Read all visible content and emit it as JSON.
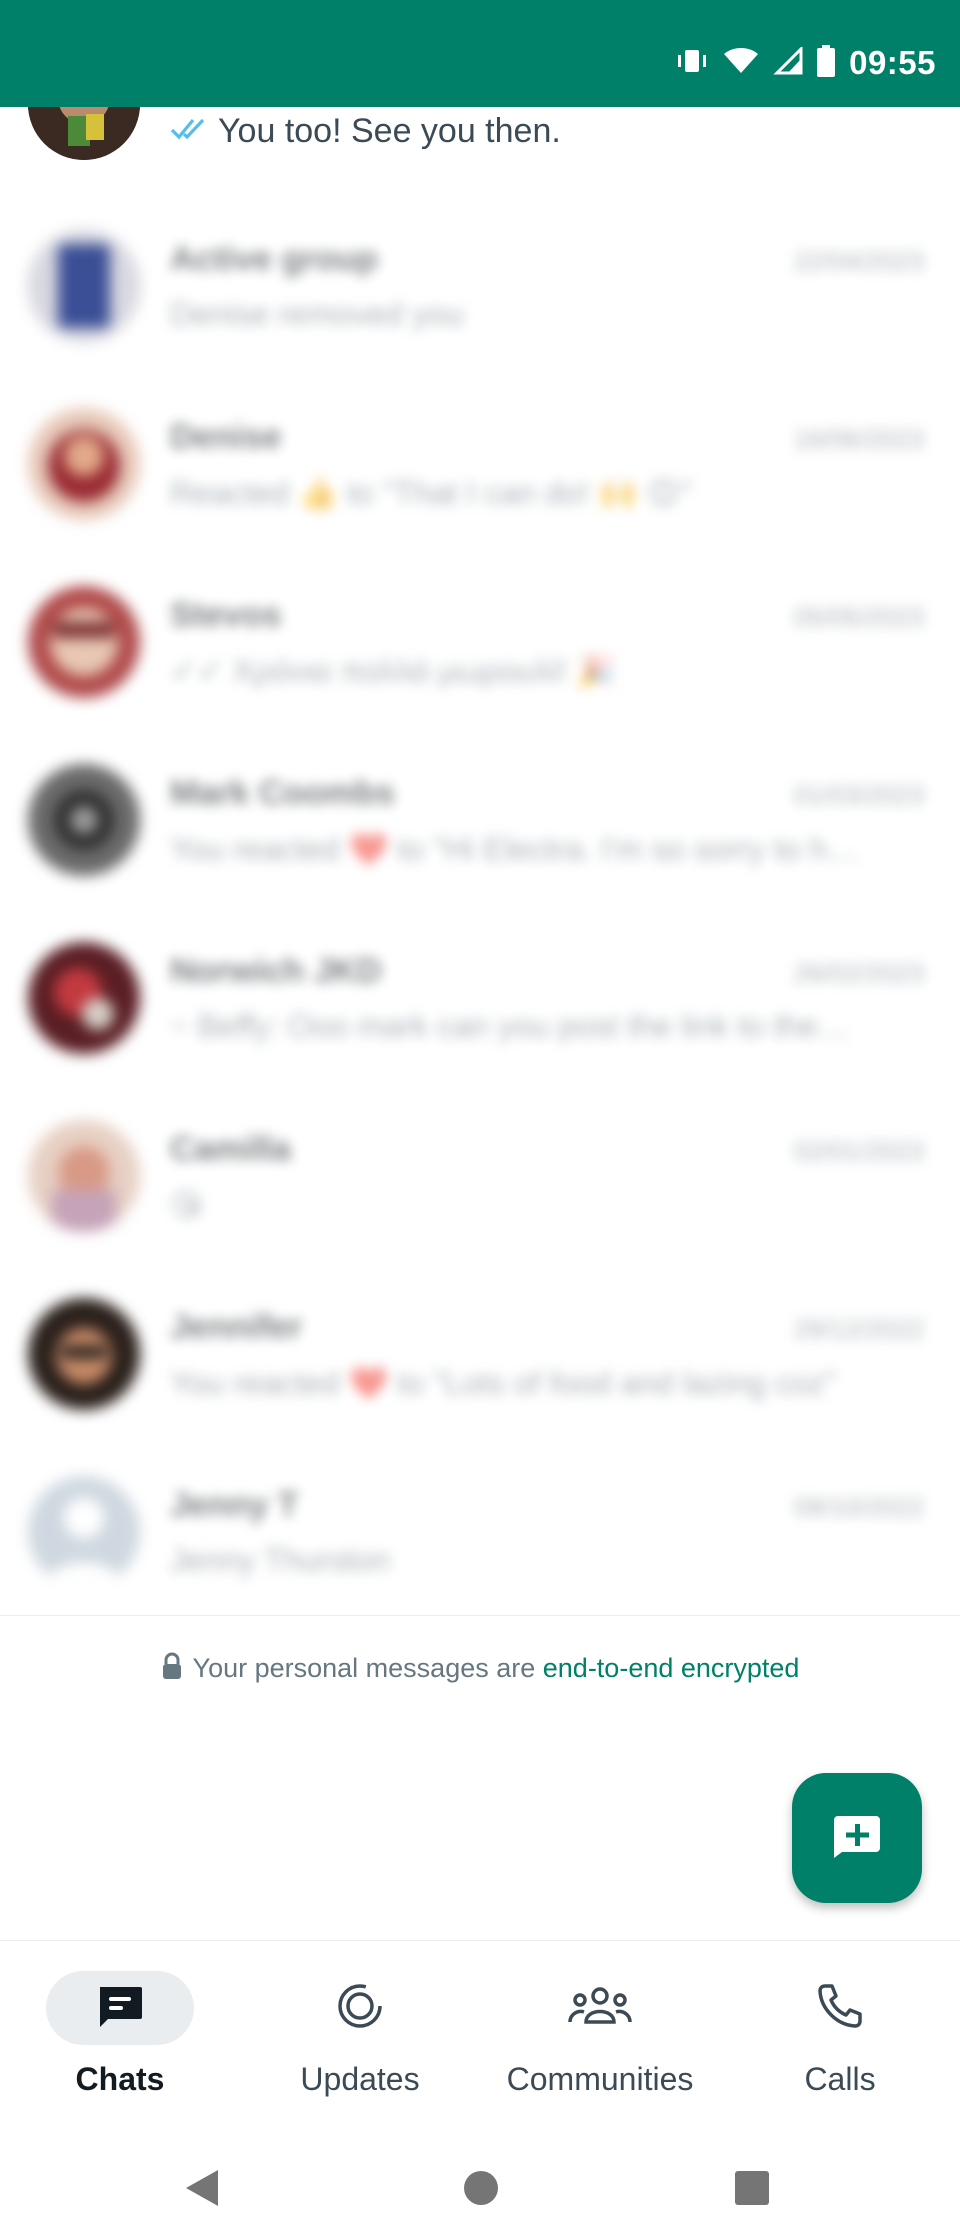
{
  "status_bar": {
    "time": "09:55",
    "icons": [
      "vibrate-icon",
      "wifi-icon",
      "signal-icon",
      "battery-icon"
    ],
    "color": "#008069"
  },
  "chats": [
    {
      "name": "",
      "preview": "You too! See you then.",
      "date": "",
      "read_receipt": "double-check-blue"
    },
    {
      "name": "Active group",
      "preview": "Denise removed you",
      "date": "22/04/2023"
    },
    {
      "name": "Denise",
      "preview": "Reacted 👍 to \"That I can do! 🙌 😊\"",
      "date": "16/06/2023"
    },
    {
      "name": "Stevos",
      "preview": "✓✓ Χρόνια πολλά μωρουλί! 🎉",
      "date": "05/05/2023"
    },
    {
      "name": "Mark Coombs",
      "preview": "You reacted ❤️ to \"Hi Electra. I'm so sorry to h…",
      "date": "01/03/2023"
    },
    {
      "name": "Norwich JKD",
      "preview": "~ Beffy: Ooo mark can you post the link to the…",
      "date": "26/02/2023"
    },
    {
      "name": "Camilla",
      "preview": "😘",
      "date": "02/01/2023"
    },
    {
      "name": "Jennifer",
      "preview": "You reacted ❤️ to \"Lots of food and lazing coz\"",
      "date": "29/12/2022"
    },
    {
      "name": "Jenny T",
      "preview": "Jenny Thurston",
      "date": "09/10/2022"
    }
  ],
  "encryption": {
    "text": "Your personal messages are ",
    "link": "end-to-end encrypted"
  },
  "fab": {
    "icon": "new-chat-icon"
  },
  "bottom_nav": [
    {
      "label": "Chats",
      "icon": "chats-icon",
      "active": true
    },
    {
      "label": "Updates",
      "icon": "updates-icon",
      "active": false
    },
    {
      "label": "Communities",
      "icon": "communities-icon",
      "active": false
    },
    {
      "label": "Calls",
      "icon": "calls-icon",
      "active": false
    }
  ],
  "colors": {
    "accent": "#008069",
    "read_tick": "#53bdeb",
    "text_secondary": "#667781"
  }
}
